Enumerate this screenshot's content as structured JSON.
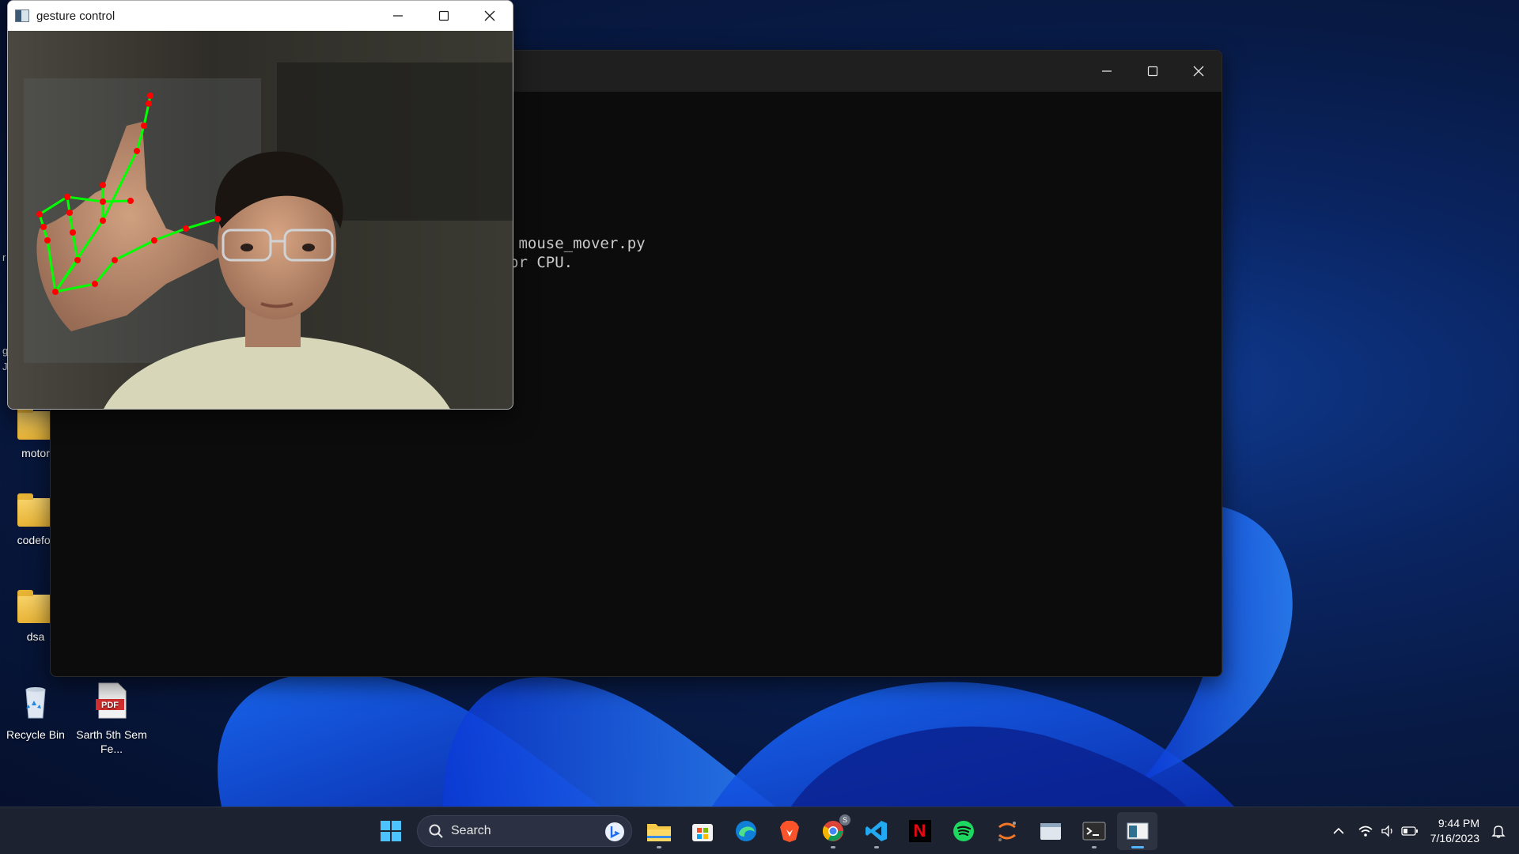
{
  "desktop": {
    "icons": [
      {
        "label": "motor",
        "icon": "folder-icon"
      },
      {
        "label": "codefor",
        "icon": "folder-icon"
      },
      {
        "label": "dsa",
        "icon": "folder-icon"
      },
      {
        "label": "Recycle Bin",
        "icon": "recycle-bin-icon"
      },
      {
        "label": "Sarth 5th Sem Fe...",
        "icon": "pdf-icon",
        "badge": "PDF"
      }
    ],
    "partial_text": [
      "r",
      "g",
      "J"
    ]
  },
  "terminal": {
    "lines": [
      " mouse_mover.py",
      "or CPU."
    ]
  },
  "camera_window": {
    "title": "gesture control",
    "overlay_colors": {
      "landmark": "#ff0000",
      "connection": "#00ff00"
    }
  },
  "taskbar": {
    "search_label": "Search",
    "pinned": [
      "windows-start-icon",
      "file-explorer-icon",
      "microsoft-store-icon",
      "edge-icon",
      "brave-icon",
      "chrome-icon",
      "vscode-icon",
      "netflix-icon",
      "spotify-icon",
      "jupyter-icon",
      "window-app-icon",
      "terminal-icon",
      "gesture-control-app-icon"
    ],
    "chrome_badge": "S",
    "netflix_letter": "N",
    "time": "9:44 PM",
    "date": "7/16/2023"
  },
  "colors": {
    "accent": "#4fb3ff",
    "taskbar": "#1c2230",
    "terminal_bg": "#0c0c0c"
  }
}
